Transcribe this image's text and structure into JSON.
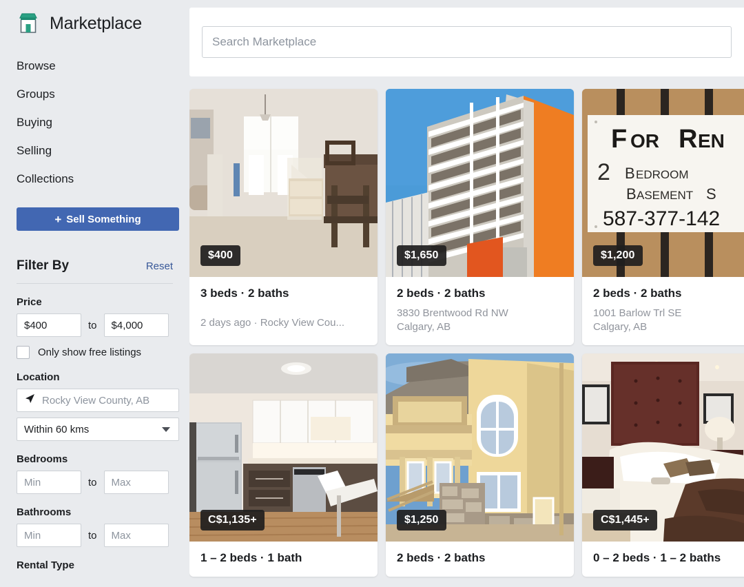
{
  "sidebar": {
    "brand": {
      "title": "Marketplace",
      "icon": "storefront-icon"
    },
    "nav": [
      {
        "label": "Browse"
      },
      {
        "label": "Groups"
      },
      {
        "label": "Buying"
      },
      {
        "label": "Selling"
      },
      {
        "label": "Collections"
      }
    ],
    "sell_button": {
      "plus": "+",
      "label": "Sell Something"
    },
    "filter": {
      "title": "Filter By",
      "reset": "Reset",
      "price": {
        "label": "Price",
        "min_value": "$400",
        "max_value": "$4,000",
        "separator": "to",
        "free_listings_label": "Only show free listings",
        "free_listings_checked": false
      },
      "location": {
        "label": "Location",
        "value": "Rocky View County, AB",
        "icon": "location-arrow-icon",
        "radius": "Within 60 kms",
        "radius_caret": "chevron-down-icon"
      },
      "bedrooms": {
        "label": "Bedrooms",
        "min_placeholder": "Min",
        "max_placeholder": "Max",
        "separator": "to"
      },
      "bathrooms": {
        "label": "Bathrooms",
        "min_placeholder": "Min",
        "max_placeholder": "Max",
        "separator": "to"
      },
      "rental_type": {
        "label": "Rental Type"
      }
    }
  },
  "search": {
    "placeholder": "Search Marketplace",
    "value": ""
  },
  "colors": {
    "accent_blue": "#4267b2",
    "link_blue": "#385898",
    "page_bg": "#e9ebee",
    "card_bg": "#ffffff",
    "badge_bg": "#201e1e",
    "brand_green": "#2aa083",
    "text_primary": "#1c1e21",
    "text_muted": "#90949c"
  },
  "listings": [
    {
      "price": "$400",
      "title": "3 beds · 2 baths",
      "address": "",
      "meta": "2 days ago · Rocky View Cou...",
      "image": "interior-entryway-photo"
    },
    {
      "price": "$1,650",
      "title": "2 beds · 2 baths",
      "address": "3830 Brentwood Rd NW\nCalgary, AB",
      "meta": "",
      "image": "highrise-apartment-photo"
    },
    {
      "price": "$1,200",
      "title": "2 beds · 2 baths",
      "address": "1001 Barlow Trl SE\nCalgary, AB",
      "meta": "",
      "image": "for-rent-sign-photo"
    },
    {
      "price": "C$1,135+",
      "title": "1 – 2 beds · 1 bath",
      "address": "",
      "meta": "",
      "image": "modern-kitchen-photo"
    },
    {
      "price": "$1,250",
      "title": "2 beds · 2 baths",
      "address": "",
      "meta": "",
      "image": "yellow-house-exterior-photo"
    },
    {
      "price": "C$1,445+",
      "title": "0 – 2 beds · 1 – 2 baths",
      "address": "",
      "meta": "",
      "image": "bedroom-interior-photo"
    }
  ]
}
